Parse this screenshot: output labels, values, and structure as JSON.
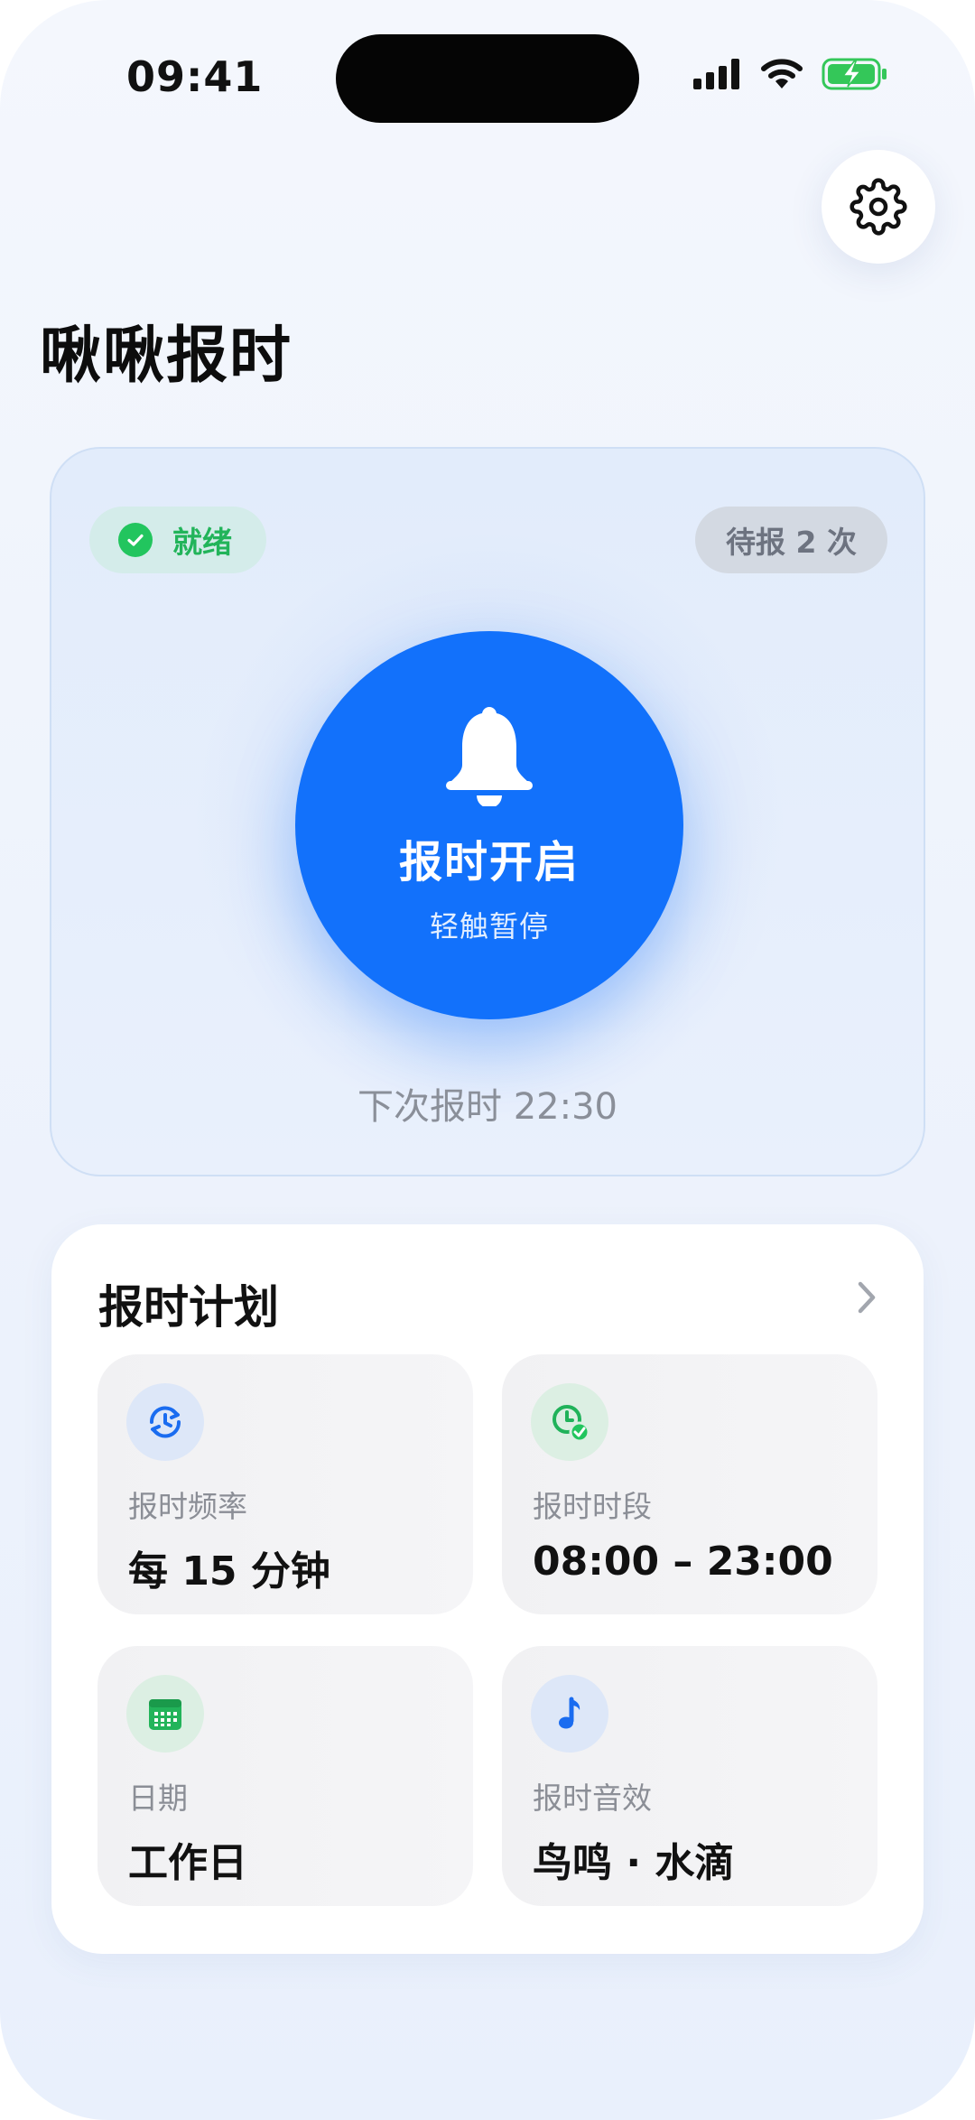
{
  "status_bar": {
    "time": "09:41"
  },
  "header": {
    "title": "啾啾报时"
  },
  "hero": {
    "status": "就绪",
    "pending": "待报 2 次",
    "button_title": "报时开启",
    "button_hint": "轻触暂停",
    "next": "下次报时 22:30"
  },
  "plan": {
    "title": "报时计划",
    "items": [
      {
        "label": "报时频率",
        "value": "每 15 分钟",
        "icon": "clock-refresh-icon"
      },
      {
        "label": "报时时段",
        "value": "08:00 – 23:00",
        "icon": "clock-check-icon"
      },
      {
        "label": "日期",
        "value": "工作日",
        "icon": "calendar-icon"
      },
      {
        "label": "报时音效",
        "value": "鸟鸣 · 水滴",
        "icon": "music-note-icon"
      }
    ]
  },
  "colors": {
    "accent": "#1271fb",
    "ready": "#22c55e",
    "battery": "#34c759"
  }
}
